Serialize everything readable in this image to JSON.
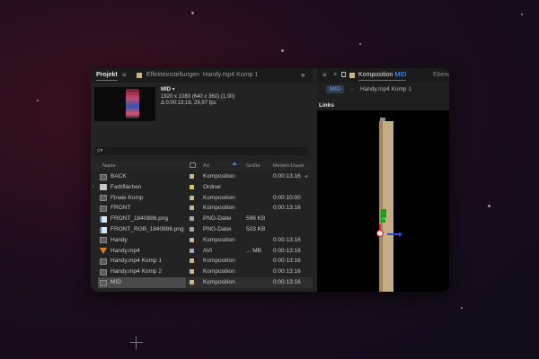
{
  "project_panel": {
    "tab_label": "Projekt",
    "effect_tab_label": "Effekteinstellungen",
    "effect_tab_target": "Handy.mp4 Komp 1",
    "selected_item": {
      "name": "MID",
      "dimensions": "1920 x 1080 (640 x 360) (1,00)",
      "duration_fps": "Δ 0:00:13:16, 29,97 fps"
    },
    "search_placeholder": "ρ▾",
    "columns": {
      "name": "Name",
      "art": "Art",
      "groesse": "Größe",
      "dauer": "Medien-Dauer"
    },
    "items": [
      {
        "name": "BACK",
        "type": "Komposition",
        "size": "",
        "duration": "0:00:13:16",
        "icon": "composition-icon",
        "label_color": "#c9b58a"
      },
      {
        "name": "Farbflächen",
        "type": "Ordner",
        "size": "",
        "duration": "",
        "icon": "folder-icon",
        "label_color": "#d8c84a"
      },
      {
        "name": "Finale Komp",
        "type": "Komposition",
        "size": "",
        "duration": "0:00:10:00",
        "icon": "composition-icon",
        "label_color": "#c9b58a"
      },
      {
        "name": "FRONT",
        "type": "Komposition",
        "size": "",
        "duration": "0:00:13:16",
        "icon": "composition-icon",
        "label_color": "#c9b58a"
      },
      {
        "name": "FRONT_1840886.png",
        "type": "PNG-Datei",
        "size": "596 KB",
        "duration": "",
        "icon": "png-file-icon",
        "label_color": "#9aa8b8"
      },
      {
        "name": "FRONT_RGB_1840886.png",
        "type": "PNG-Datei",
        "size": "503 KB",
        "duration": "",
        "icon": "png-file-icon",
        "label_color": "#9aa8b8"
      },
      {
        "name": "Handy",
        "type": "Komposition",
        "size": "",
        "duration": "0:00:13:16",
        "icon": "composition-icon",
        "label_color": "#c9b58a"
      },
      {
        "name": "Handy.mp4",
        "type": "AVI",
        "size": "... MB",
        "duration": "0:00:13:16",
        "icon": "video-file-icon",
        "label_color": "#9aa8b8"
      },
      {
        "name": "Handy.mp4 Komp 1",
        "type": "Komposition",
        "size": "",
        "duration": "0:00:13:16",
        "icon": "composition-icon",
        "label_color": "#c9b58a"
      },
      {
        "name": "Handy.mp4 Komp 2",
        "type": "Komposition",
        "size": "",
        "duration": "0:00:13:16",
        "icon": "composition-icon",
        "label_color": "#c9b58a"
      },
      {
        "name": "MID",
        "type": "Komposition",
        "size": "",
        "duration": "0:00:13:16",
        "icon": "composition-icon",
        "label_color": "#c9b58a",
        "selected": true
      }
    ]
  },
  "composition_panel": {
    "tab_prefix": "Komposition",
    "tab_comp": "MID",
    "ebene_tab": "Ebene",
    "breadcrumb_active": "MID",
    "breadcrumb_other": "Handy.mp4 Komp 1",
    "view_label": "Links"
  },
  "colors": {
    "accent": "#2d7cd6",
    "panel_bg": "#232323",
    "viewer_bg": "#000000",
    "composition_label": "#c9b58a"
  }
}
